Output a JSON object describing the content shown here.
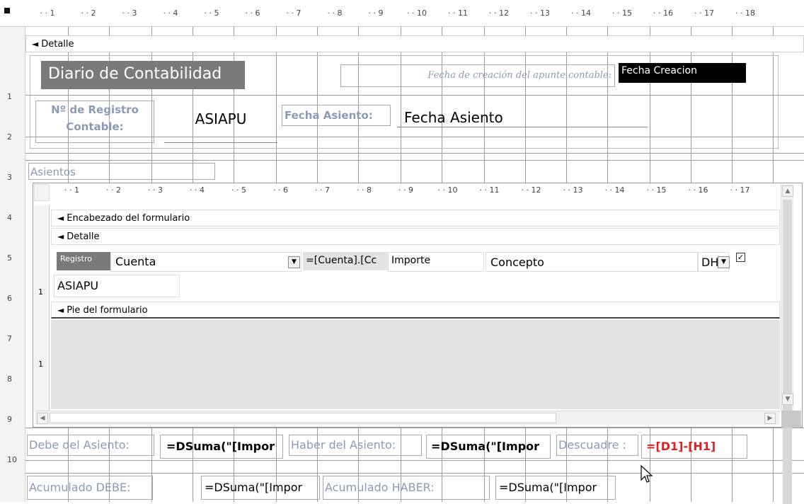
{
  "ruler_top": [
    "1",
    "2",
    "3",
    "4",
    "5",
    "6",
    "7",
    "8",
    "9",
    "10",
    "11",
    "12",
    "13",
    "14",
    "15",
    "16",
    "17",
    "18"
  ],
  "ruler_left": [
    "1",
    "2",
    "3",
    "4",
    "5",
    "6",
    "7",
    "8",
    "9",
    "10"
  ],
  "sections": {
    "detalle": "Detalle"
  },
  "header": {
    "title": "Diario de Contabilidad",
    "fecha_creacion_label": "Fecha de creación del apunte contable:",
    "fecha_creacion_value": "Fecha Creacion",
    "registro_label_line1": "Nº de Registro",
    "registro_label_line2": "Contable:",
    "registro_value": "ASIAPU",
    "fecha_asiento_label": "Fecha Asiento:",
    "fecha_asiento_value": "Fecha Asiento"
  },
  "subform": {
    "label": "Asientos",
    "ruler": [
      "1",
      "2",
      "3",
      "4",
      "5",
      "6",
      "7",
      "8",
      "9",
      "10",
      "11",
      "12",
      "13",
      "14",
      "15",
      "16",
      "17"
    ],
    "encabezado": "Encabezado del formulario",
    "detalle": "Detalle",
    "pie": "Pie del formulario",
    "registro_label": "Registro",
    "cuenta": "Cuenta",
    "cuenta_expr": "=[Cuenta].[Cc",
    "importe": "Importe",
    "concepto": "Concepto",
    "dh": "DH",
    "asiapu": "ASIAPU",
    "left_ruler": [
      "1",
      "1"
    ]
  },
  "footer": {
    "debe_label": "Debe del Asiento:",
    "debe_expr": "=DSuma(\"[Impor",
    "haber_label": "Haber del Asiento:",
    "haber_expr": "=DSuma(\"[Impor",
    "descuadre_label": "Descuadre :",
    "descuadre_expr": "=[D1]-[H1]",
    "acum_debe_label": "Acumulado DEBE:",
    "acum_debe_expr": "=DSuma(\"[Impor",
    "acum_haber_label": "Acumulado HABER:",
    "acum_haber_expr": "=DSuma(\"[Impor"
  }
}
